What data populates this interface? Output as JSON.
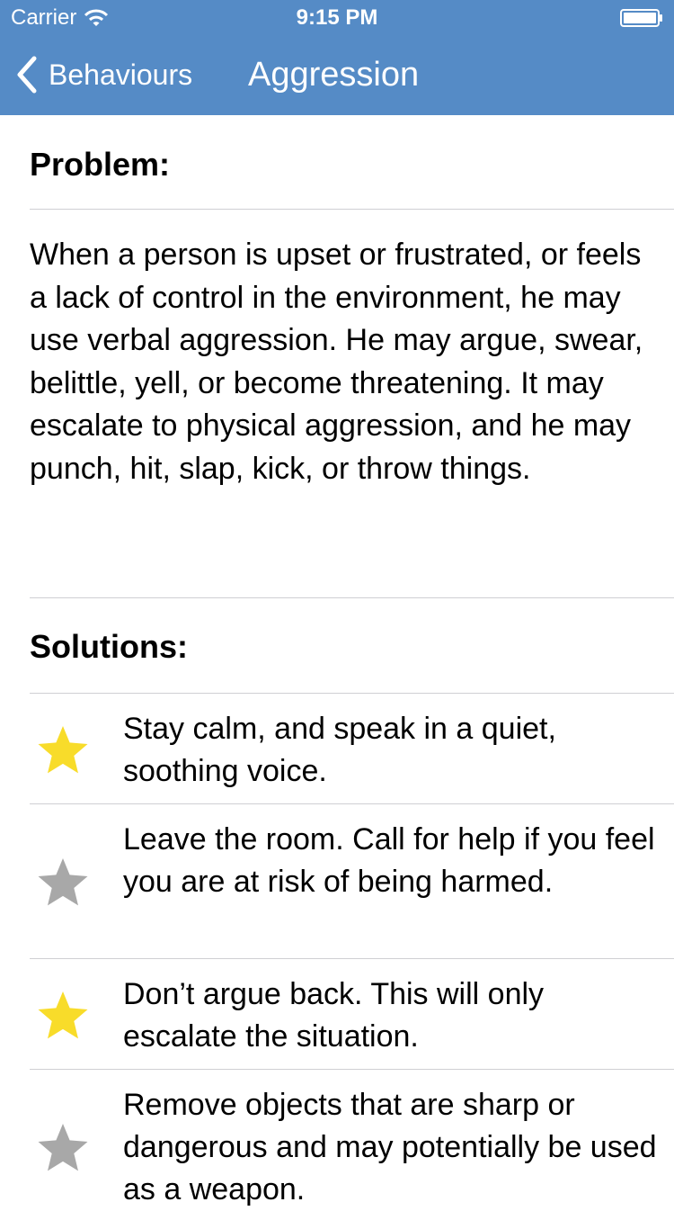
{
  "status_bar": {
    "carrier": "Carrier",
    "time": "9:15 PM"
  },
  "nav": {
    "back_label": "Behaviours",
    "title": "Aggression"
  },
  "problem": {
    "heading": "Problem:",
    "text": "When a person is upset or frustrated, or feels a lack of control in the environment, he may use verbal aggression. He may argue, swear, belittle, yell, or become threatening. It may escalate to physical aggression, and he may punch, hit, slap, kick, or throw things."
  },
  "solutions": {
    "heading": "Solutions:",
    "items": [
      {
        "text": "Stay calm, and speak in a quiet, soothing voice.",
        "starred": true
      },
      {
        "text": "Leave the room. Call for help if you feel you are at risk of being harmed.",
        "starred": false
      },
      {
        "text": "Don’t argue back. This will only escalate the situation.",
        "starred": true
      },
      {
        "text": "Remove objects that are sharp or dangerous and may potentially be used as a weapon.",
        "starred": false
      }
    ]
  },
  "colors": {
    "nav_background": "#558bc6",
    "star_active": "#f8dc2a",
    "star_inactive": "#a8a8a8",
    "divider": "#cfcfd3"
  }
}
